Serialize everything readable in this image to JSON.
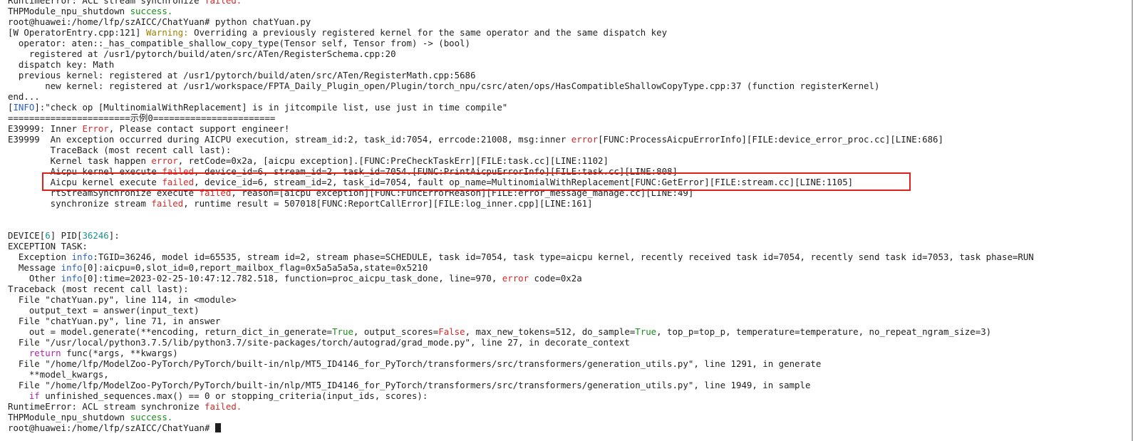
{
  "terminal": {
    "lines": [
      [
        {
          "t": "RuntimeError: ACL stream synchronize "
        },
        {
          "t": "failed.",
          "c": "red"
        }
      ],
      [
        {
          "t": "THPModule_npu_shutdown "
        },
        {
          "t": "success.",
          "c": "green"
        }
      ],
      [
        {
          "t": "root@huawei:/home/lfp/szAICC/ChatYuan# python chatYuan.py"
        }
      ],
      [
        {
          "t": "[W OperatorEntry.cpp:121] "
        },
        {
          "t": "Warning:",
          "c": "yellow"
        },
        {
          "t": " Overriding a previously registered kernel for the same operator and the same dispatch key"
        }
      ],
      [
        {
          "t": "  operator: aten::_has_compatible_shallow_copy_type(Tensor self, Tensor from) -> (bool)"
        }
      ],
      [
        {
          "t": "    registered at /usr1/pytorch/build/aten/src/ATen/RegisterSchema.cpp:20"
        }
      ],
      [
        {
          "t": "  dispatch key: Math"
        }
      ],
      [
        {
          "t": "  previous kernel: registered at /usr1/pytorch/build/aten/src/ATen/RegisterMath.cpp:5686"
        }
      ],
      [
        {
          "t": "       new kernel: registered at /usr1/workspace/FPTA_Daily_Plugin_open/Plugin/torch_npu/csrc/aten/ops/HasCompatibleShallowCopyType.cpp:37 (function registerKernel)"
        }
      ],
      [
        {
          "t": "end..."
        }
      ],
      [
        {
          "t": "["
        },
        {
          "t": "INFO",
          "c": "blue"
        },
        {
          "t": "]:\"check op [MultinomialWithReplacement] is in jitcompile list, use just in time compile\""
        }
      ],
      [
        {
          "t": "=======================示例0======================="
        }
      ],
      [
        {
          "t": "E39999: Inner "
        },
        {
          "t": "Error",
          "c": "red"
        },
        {
          "t": ", Please contact support engineer!"
        }
      ],
      [
        {
          "t": "E39999  An exception occurred during AICPU execution, stream_id:2, task_id:7054, errcode:21008, msg:inner "
        },
        {
          "t": "error",
          "c": "red"
        },
        {
          "t": "[FUNC:ProcessAicpuErrorInfo][FILE:device_error_proc.cc][LINE:686]"
        }
      ],
      [
        {
          "t": "        TraceBack (most recent call last):"
        }
      ],
      [
        {
          "t": "        Kernel task happen "
        },
        {
          "t": "error",
          "c": "red"
        },
        {
          "t": ", retCode=0x2a, [aicpu exception].[FUNC:PreCheckTaskErr][FILE:task.cc][LINE:1102]"
        }
      ],
      [
        {
          "t": "        Aicpu kernel execute "
        },
        {
          "t": "failed",
          "c": "red"
        },
        {
          "t": ", device_id=6, stream_id=2, task_id=7054.[FUNC:PrintAicpuErrorInfo][FILE:task.cc][LINE:808]"
        }
      ],
      [
        {
          "t": "        Aicpu kernel execute "
        },
        {
          "t": "failed",
          "c": "red"
        },
        {
          "t": ", device_id=6, stream_id=2, task_id=7054, fault op_name=MultinomialWithReplacement[FUNC:GetError][FILE:stream.cc][LINE:1105]"
        }
      ],
      [
        {
          "t": "        rtStreamSynchronize execute "
        },
        {
          "t": "failed",
          "c": "red"
        },
        {
          "t": ", reason=[aicpu exception][FUNC:FuncErrorReason][FILE:error_message_manage.cc][LINE:49]"
        }
      ],
      [
        {
          "t": "        synchronize stream "
        },
        {
          "t": "failed",
          "c": "red"
        },
        {
          "t": ", runtime result = 507018[FUNC:ReportCallError][FILE:log_inner.cpp][LINE:161]"
        }
      ],
      [
        {
          "t": ""
        }
      ],
      [
        {
          "t": ""
        }
      ],
      [
        {
          "t": "DEVICE["
        },
        {
          "t": "6",
          "c": "cyan"
        },
        {
          "t": "] PID["
        },
        {
          "t": "36246",
          "c": "cyan"
        },
        {
          "t": "]:"
        }
      ],
      [
        {
          "t": "EXCEPTION TASK:"
        }
      ],
      [
        {
          "t": "  Exception "
        },
        {
          "t": "info",
          "c": "blue"
        },
        {
          "t": ":TGID=36246, model id=65535, stream id=2, stream phase=SCHEDULE, task id=7054, task type=aicpu kernel, recently received task id=7054, recently send task id=7053, task phase=RUN"
        }
      ],
      [
        {
          "t": "  Message "
        },
        {
          "t": "info",
          "c": "blue"
        },
        {
          "t": "[0]:aicpu=0,slot_id=0,report_mailbox_flag=0x5a5a5a5a,state=0x5210"
        }
      ],
      [
        {
          "t": "    Other "
        },
        {
          "t": "info",
          "c": "blue"
        },
        {
          "t": "[0]:time=2023-02-25-10:47:12.782.518, function=proc_aicpu_task_done, line=970, "
        },
        {
          "t": "error",
          "c": "red"
        },
        {
          "t": " code=0x2a"
        }
      ],
      [
        {
          "t": "Traceback (most recent call last):"
        }
      ],
      [
        {
          "t": "  File \"chatYuan.py\", line 114, in <module>"
        }
      ],
      [
        {
          "t": "    output_text = answer(input_text)"
        }
      ],
      [
        {
          "t": "  File \"chatYuan.py\", line 71, in answer"
        }
      ],
      [
        {
          "t": "    out = model.generate(**encoding, return_dict_in_generate="
        },
        {
          "t": "True",
          "c": "green"
        },
        {
          "t": ", output_scores="
        },
        {
          "t": "False",
          "c": "red"
        },
        {
          "t": ", max_new_tokens=512, do_sample="
        },
        {
          "t": "True",
          "c": "green"
        },
        {
          "t": ", top_p=top_p, temperature=temperature, no_repeat_ngram_size=3)"
        }
      ],
      [
        {
          "t": "  File \"/usr/local/python3.7.5/lib/python3.7/site-packages/torch/autograd/grad_mode.py\", line 27, in decorate_context"
        }
      ],
      [
        {
          "t": "    "
        },
        {
          "t": "return",
          "c": "magenta"
        },
        {
          "t": " func(*args, **kwargs)"
        }
      ],
      [
        {
          "t": "  File \"/home/lfp/ModelZoo-PyTorch/PyTorch/built-in/nlp/MT5_ID4146_for_PyTorch/transformers/src/transformers/generation_utils.py\", line 1291, in generate"
        }
      ],
      [
        {
          "t": "    **model_kwargs,"
        }
      ],
      [
        {
          "t": "  File \"/home/lfp/ModelZoo-PyTorch/PyTorch/built-in/nlp/MT5_ID4146_for_PyTorch/transformers/src/transformers/generation_utils.py\", line 1949, in sample"
        }
      ],
      [
        {
          "t": "    "
        },
        {
          "t": "if",
          "c": "magenta"
        },
        {
          "t": " unfinished_sequences.max() == 0 or stopping_criteria(input_ids, scores):"
        }
      ],
      [
        {
          "t": "RuntimeError: ACL stream synchronize "
        },
        {
          "t": "failed.",
          "c": "red"
        }
      ],
      [
        {
          "t": "THPModule_npu_shutdown "
        },
        {
          "t": "success.",
          "c": "green"
        }
      ],
      [
        {
          "t": "root@huawei:/home/lfp/szAICC/ChatYuan# "
        }
      ]
    ],
    "highlighted_line_index": 17,
    "colors": {
      "red": "#d42828",
      "green": "#1a8c1a",
      "yellow": "#a08000",
      "blue": "#2a5fd0",
      "cyan": "#1a9090",
      "magenta": "#b020b0",
      "highlight_box": "#e0201a"
    }
  }
}
